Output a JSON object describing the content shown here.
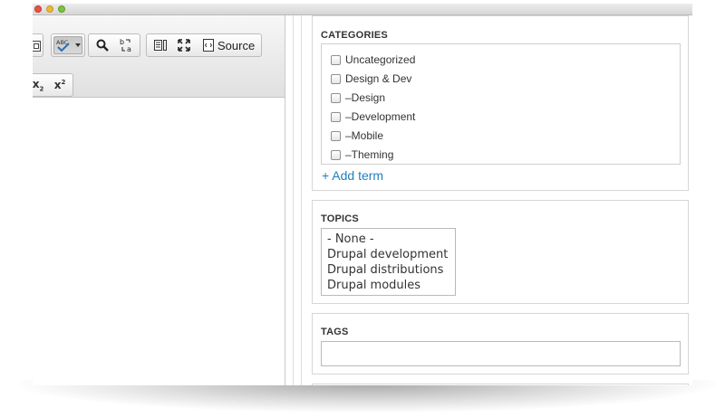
{
  "window": {
    "controls": [
      "close",
      "minimize",
      "zoom"
    ]
  },
  "toolbar": {
    "spellcheck_icon_text": "ABC",
    "source_label": "Source",
    "subscript_text": "x",
    "subscript_suffix": "2",
    "superscript_text": "x",
    "superscript_suffix": "2"
  },
  "categories": {
    "legend": "CATEGORIES",
    "items": [
      "Uncategorized",
      "Design & Dev",
      "–Design",
      "–Development",
      "–Mobile",
      "–Theming"
    ],
    "add_term": "+ Add term"
  },
  "topics": {
    "legend": "TOPICS",
    "options": [
      "- None -",
      "Drupal development",
      "Drupal distributions",
      "Drupal modules"
    ]
  },
  "tags": {
    "legend": "TAGS",
    "value": ""
  }
}
